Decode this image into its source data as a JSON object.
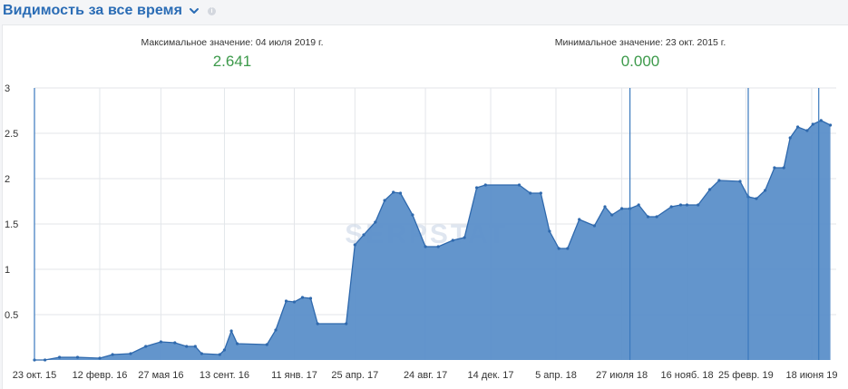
{
  "header": {
    "title": "Видимость за все время",
    "dropdown_icon": "chevron-down-icon",
    "info_icon": "info-icon",
    "info_glyph": "i"
  },
  "stats": {
    "max_label": "Максимальное значение: 04 июля 2019 г.",
    "max_value": "2.641",
    "min_label": "Минимальное значение: 23 окт. 2015 г.",
    "min_value": "0.000"
  },
  "watermark": "SERPSTAT",
  "colors": {
    "accent": "#2a6cb5",
    "series_fill": "#5b8fc9",
    "series_line": "#2f69ad",
    "value_green": "#3d9a4b"
  },
  "chart_data": {
    "type": "area",
    "title": "",
    "xlabel": "",
    "ylabel": "",
    "ylim": [
      0,
      3
    ],
    "grid": true,
    "xlim": [
      "2015-10-23",
      "2019-07-30"
    ],
    "yticks": [
      0.5,
      1,
      1.5,
      2,
      2.5,
      3
    ],
    "ytick_labels": [
      "0.5",
      "1",
      "1.5",
      "2",
      "2.5",
      "3"
    ],
    "xticks": [
      {
        "date": "2015-10-23",
        "label": "23 окт. 15"
      },
      {
        "date": "2016-02-12",
        "label": "12 февр. 16"
      },
      {
        "date": "2016-05-27",
        "label": "27 мая 16"
      },
      {
        "date": "2016-09-13",
        "label": "13 сент. 16"
      },
      {
        "date": "2017-01-11",
        "label": "11 янв. 17"
      },
      {
        "date": "2017-04-25",
        "label": "25 апр. 17"
      },
      {
        "date": "2017-08-24",
        "label": "24 авг. 17"
      },
      {
        "date": "2017-12-14",
        "label": "14 дек. 17"
      },
      {
        "date": "2018-04-05",
        "label": "5 апр. 18"
      },
      {
        "date": "2018-07-27",
        "label": "27 июля 18"
      },
      {
        "date": "2018-11-16",
        "label": "16 нояб. 18"
      },
      {
        "date": "2019-02-25",
        "label": "25 февр. 19"
      },
      {
        "date": "2019-06-18",
        "label": "18 июня 19"
      }
    ],
    "markers": [
      "2015-10-23",
      "2018-08-10",
      "2019-03-01",
      "2019-06-30"
    ],
    "series": [
      {
        "values": [
          [
            "2015-10-23",
            0.0
          ],
          [
            "2015-11-10",
            0.0
          ],
          [
            "2015-12-05",
            0.03
          ],
          [
            "2016-01-05",
            0.03
          ],
          [
            "2016-02-12",
            0.02
          ],
          [
            "2016-03-05",
            0.06
          ],
          [
            "2016-04-05",
            0.07
          ],
          [
            "2016-05-01",
            0.15
          ],
          [
            "2016-05-27",
            0.2
          ],
          [
            "2016-06-20",
            0.19
          ],
          [
            "2016-07-10",
            0.15
          ],
          [
            "2016-07-25",
            0.15
          ],
          [
            "2016-08-05",
            0.07
          ],
          [
            "2016-09-05",
            0.06
          ],
          [
            "2016-09-13",
            0.11
          ],
          [
            "2016-09-25",
            0.32
          ],
          [
            "2016-10-05",
            0.18
          ],
          [
            "2016-11-25",
            0.17
          ],
          [
            "2016-12-10",
            0.33
          ],
          [
            "2016-12-28",
            0.65
          ],
          [
            "2017-01-11",
            0.64
          ],
          [
            "2017-01-25",
            0.69
          ],
          [
            "2017-02-08",
            0.68
          ],
          [
            "2017-02-20",
            0.4
          ],
          [
            "2017-04-10",
            0.4
          ],
          [
            "2017-04-25",
            1.27
          ],
          [
            "2017-05-10",
            1.38
          ],
          [
            "2017-05-30",
            1.52
          ],
          [
            "2017-06-15",
            1.76
          ],
          [
            "2017-06-30",
            1.85
          ],
          [
            "2017-07-12",
            1.84
          ],
          [
            "2017-08-02",
            1.6
          ],
          [
            "2017-08-24",
            1.25
          ],
          [
            "2017-09-15",
            1.25
          ],
          [
            "2017-10-10",
            1.32
          ],
          [
            "2017-10-30",
            1.35
          ],
          [
            "2017-11-20",
            1.9
          ],
          [
            "2017-12-05",
            1.93
          ],
          [
            "2018-02-01",
            1.93
          ],
          [
            "2018-02-20",
            1.84
          ],
          [
            "2018-03-10",
            1.84
          ],
          [
            "2018-03-25",
            1.42
          ],
          [
            "2018-04-10",
            1.23
          ],
          [
            "2018-04-25",
            1.23
          ],
          [
            "2018-05-15",
            1.55
          ],
          [
            "2018-06-10",
            1.48
          ],
          [
            "2018-06-28",
            1.69
          ],
          [
            "2018-07-10",
            1.6
          ],
          [
            "2018-07-27",
            1.67
          ],
          [
            "2018-08-10",
            1.67
          ],
          [
            "2018-08-25",
            1.71
          ],
          [
            "2018-09-10",
            1.58
          ],
          [
            "2018-09-25",
            1.58
          ],
          [
            "2018-10-20",
            1.69
          ],
          [
            "2018-11-05",
            1.71
          ],
          [
            "2018-11-16",
            1.71
          ],
          [
            "2018-12-05",
            1.71
          ],
          [
            "2018-12-25",
            1.88
          ],
          [
            "2019-01-10",
            1.98
          ],
          [
            "2019-02-15",
            1.97
          ],
          [
            "2019-03-01",
            1.8
          ],
          [
            "2019-03-15",
            1.78
          ],
          [
            "2019-03-30",
            1.87
          ],
          [
            "2019-04-15",
            2.12
          ],
          [
            "2019-05-01",
            2.12
          ],
          [
            "2019-05-12",
            2.45
          ],
          [
            "2019-05-25",
            2.57
          ],
          [
            "2019-06-10",
            2.53
          ],
          [
            "2019-06-20",
            2.6
          ],
          [
            "2019-07-04",
            2.641
          ],
          [
            "2019-07-20",
            2.59
          ]
        ]
      }
    ]
  }
}
